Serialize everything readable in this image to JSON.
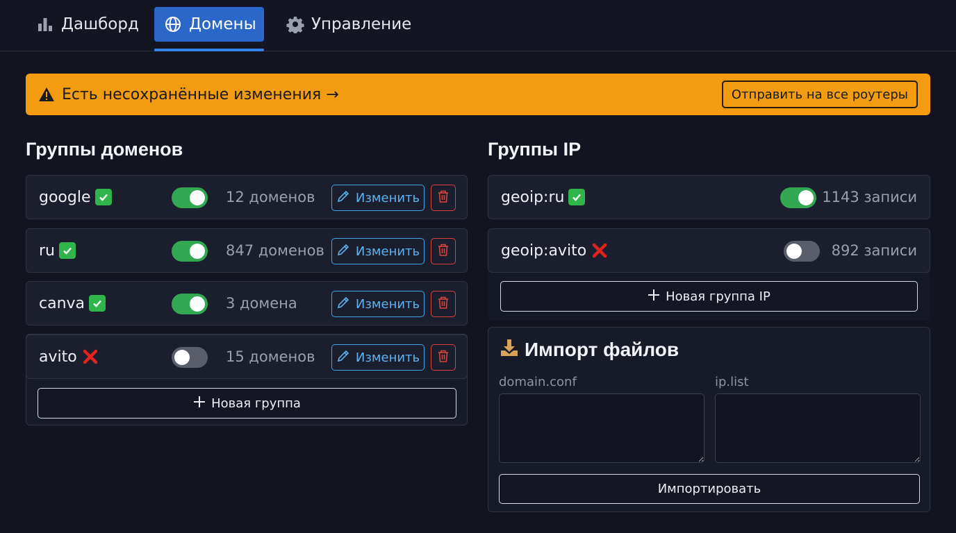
{
  "nav": {
    "tabs": [
      {
        "label": "Дашборд",
        "icon": "bar-chart-icon",
        "active": false
      },
      {
        "label": "Домены",
        "icon": "globe-icon",
        "active": true
      },
      {
        "label": "Управление",
        "icon": "gear-icon",
        "active": false
      }
    ]
  },
  "banner": {
    "message": "Есть несохранённые изменения →",
    "button_label": "Отправить на все роутеры",
    "color": "#f39c12"
  },
  "domain_groups": {
    "title": "Группы доменов",
    "items": [
      {
        "name": "google",
        "status": "ok",
        "enabled": true,
        "count": "12 доменов",
        "edit_label": "Изменить"
      },
      {
        "name": "ru",
        "status": "ok",
        "enabled": true,
        "count": "847 доменов",
        "edit_label": "Изменить"
      },
      {
        "name": "canva",
        "status": "ok",
        "enabled": true,
        "count": "3 домена",
        "edit_label": "Изменить"
      },
      {
        "name": "avito",
        "status": "error",
        "enabled": false,
        "count": "15 доменов",
        "edit_label": "Изменить"
      }
    ],
    "add_label": "Новая группа"
  },
  "ip_groups": {
    "title": "Группы IP",
    "items": [
      {
        "name": "geoip:ru",
        "status": "ok",
        "enabled": true,
        "count": "1143 записи"
      },
      {
        "name": "geoip:avito",
        "status": "error",
        "enabled": false,
        "count": "892 записи"
      }
    ],
    "add_label": "Новая группа IP"
  },
  "import": {
    "title": "Импорт файлов",
    "domain_label": "domain.conf",
    "ip_label": "ip.list",
    "button_label": "Импортировать"
  },
  "colors": {
    "accent": "#2a67c8",
    "toggle_on": "#33a853",
    "edit": "#4aa3e8",
    "delete": "#d9453d"
  }
}
